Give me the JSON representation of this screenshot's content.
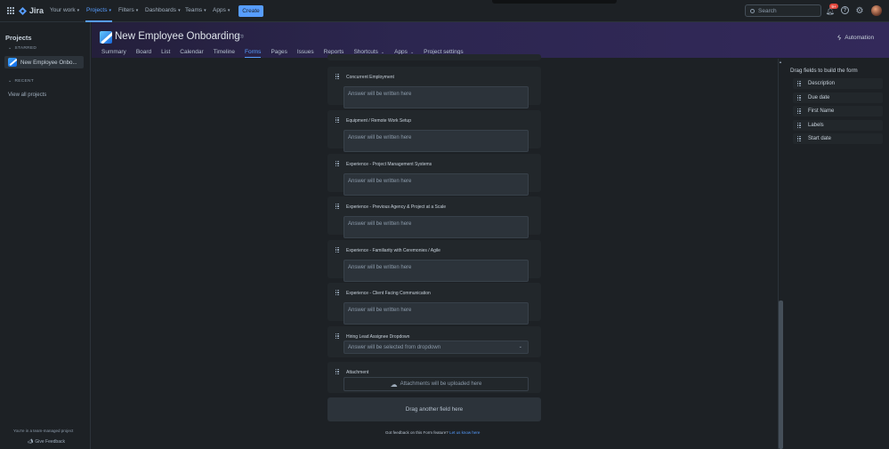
{
  "topnav": {
    "brand": "Jira",
    "items": [
      {
        "label": "Your work",
        "active": false
      },
      {
        "label": "Projects",
        "active": true
      },
      {
        "label": "Filters",
        "active": false
      },
      {
        "label": "Dashboards",
        "active": false
      },
      {
        "label": "Teams",
        "active": false
      },
      {
        "label": "Apps",
        "active": false
      }
    ],
    "create_label": "Create",
    "search_placeholder": "Search",
    "notification_count": "9+",
    "help_glyph": "?"
  },
  "sidebar": {
    "title": "Projects",
    "starred_label": "STARRED",
    "starred_item": "New Employee Onbo...",
    "recent_label": "RECENT",
    "view_all": "View all projects",
    "footer_note": "You're in a team-managed project",
    "feedback": "Give Feedback"
  },
  "project": {
    "title": "New Employee Onboarding",
    "automation": "Automation",
    "tabs": [
      {
        "label": "Summary",
        "active": false,
        "dropdown": false
      },
      {
        "label": "Board",
        "active": false,
        "dropdown": false
      },
      {
        "label": "List",
        "active": false,
        "dropdown": false
      },
      {
        "label": "Calendar",
        "active": false,
        "dropdown": false
      },
      {
        "label": "Timeline",
        "active": false,
        "dropdown": false
      },
      {
        "label": "Forms",
        "active": true,
        "dropdown": false
      },
      {
        "label": "Pages",
        "active": false,
        "dropdown": false
      },
      {
        "label": "Issues",
        "active": false,
        "dropdown": false
      },
      {
        "label": "Reports",
        "active": false,
        "dropdown": false
      },
      {
        "label": "Shortcuts",
        "active": false,
        "dropdown": true
      },
      {
        "label": "Apps",
        "active": false,
        "dropdown": true
      },
      {
        "label": "Project settings",
        "active": false,
        "dropdown": false
      }
    ]
  },
  "form": {
    "fields": [
      {
        "label": "Concurrent Employment",
        "placeholder": "Answer will be written here"
      },
      {
        "label": "Equipment / Remote Work Setup",
        "placeholder": "Answer will be written here"
      },
      {
        "label": "Experience - Project Management Systems",
        "placeholder": "Answer will be written here"
      },
      {
        "label": "Experience - Previous Agency & Project at a Scale",
        "placeholder": "Answer will be written here"
      },
      {
        "label": "Experience - Familiarity with Ceremonies / Agile",
        "placeholder": "Answer will be written here"
      },
      {
        "label": "Experience - Client Facing Communication",
        "placeholder": "Answer will be written here"
      }
    ],
    "dropdown_field": {
      "label": "Hiring Lead Assignee Dropdown",
      "placeholder": "Answer will be selected from dropdown"
    },
    "attachment_field": {
      "label": "Attachment",
      "placeholder": "Attachments will be uploaded here"
    },
    "drag_zone": "Drag another field here",
    "feedback_text": "Got feedback on this Form feature?",
    "feedback_link": "Let us know here"
  },
  "panel": {
    "title": "Drag fields to build the form",
    "items": [
      "Description",
      "Due date",
      "First Name",
      "Labels",
      "Start date"
    ]
  },
  "colors": {
    "accent": "#579dff",
    "background": "#1d2125",
    "card": "#22272b",
    "header_gradient_end": "#33295a",
    "badge": "#e2483d"
  }
}
